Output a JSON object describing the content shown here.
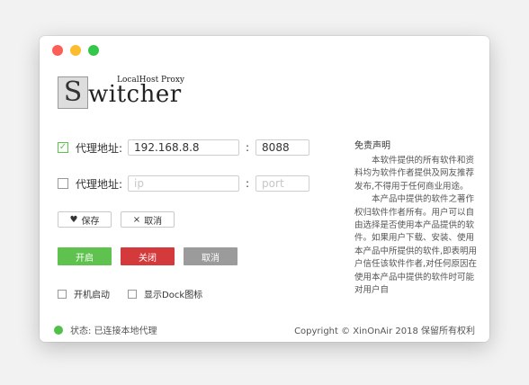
{
  "logo": {
    "subtitle": "LocalHost Proxy",
    "initial": "S",
    "word": "witcher"
  },
  "proxy1": {
    "checked": "✓",
    "label": "代理地址:",
    "ip_value": "192.168.8.8",
    "colon": ":",
    "port_value": "8088"
  },
  "proxy2": {
    "label": "代理地址:",
    "ip_placeholder": "ip",
    "colon": ":",
    "port_placeholder": "port"
  },
  "actions": {
    "save_icon": "♥",
    "save": "保存",
    "cancel_icon": "×",
    "cancel": "取消"
  },
  "controls": {
    "open": "开启",
    "close": "关闭",
    "cancel": "取消"
  },
  "colors": {
    "open": "#5fc24e",
    "close": "#d4393b",
    "cancel": "#9b9b9b"
  },
  "options": {
    "startup": "开机启动",
    "dock": "显示Dock图标"
  },
  "status": {
    "text": "状态: 已连接本地代理"
  },
  "footer": {
    "copyright": "Copyright © XinOnAir 2018 保留所有权利"
  },
  "disclaimer": {
    "title": "免责声明",
    "p1": "本软件提供的所有软件和资料均为软件作者提供及网友推荐发布,不得用于任何商业用途。",
    "p2": "本产品中提供的软件之著作权归软件作者所有。用户可以自由选择是否使用本产品提供的软件。如果用户下载、安装、使用本产品中所提供的软件,即表明用户信任该软件作者,对任何原因在使用本产品中提供的软件时可能对用户自"
  }
}
